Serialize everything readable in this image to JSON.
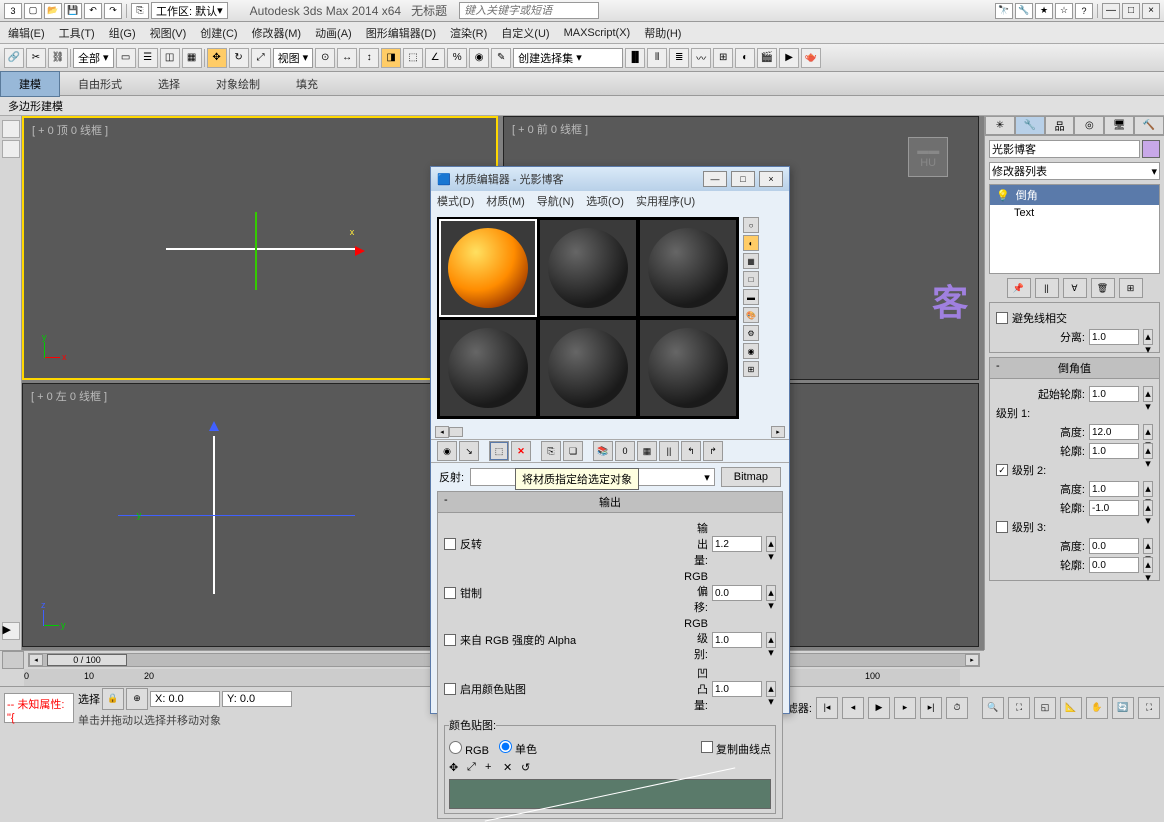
{
  "titlebar": {
    "workspace_label": "工作区: 默认",
    "app_title": "Autodesk 3ds Max  2014 x64",
    "doc_title": "无标题",
    "search_placeholder": "键入关键字或短语"
  },
  "menubar": [
    "编辑(E)",
    "工具(T)",
    "组(G)",
    "视图(V)",
    "创建(C)",
    "修改器(M)",
    "动画(A)",
    "图形编辑器(D)",
    "渲染(R)",
    "自定义(U)",
    "MAXScript(X)",
    "帮助(H)"
  ],
  "toolbar": {
    "filter": "全部",
    "coord": "视图",
    "selset": "创建选择集"
  },
  "ribbon": {
    "tabs": [
      "建模",
      "自由形式",
      "选择",
      "对象绘制",
      "填充"
    ],
    "active": 0,
    "sub": "多边形建模"
  },
  "viewports": {
    "tl": "[ + 0 顶 0 线框 ]",
    "tr": "[ + 0 前 0 线框 ]",
    "bl": "[ + 0 左 0 线框 ]"
  },
  "cmdpanel": {
    "name": "光影博客",
    "modlist": "修改器列表",
    "stack": [
      {
        "label": "倒角",
        "icon": "💡"
      },
      {
        "label": "Text",
        "icon": ""
      }
    ],
    "rollout1": {
      "title": "",
      "avoid_overlap": "避免线相交",
      "separate": "分离:",
      "separate_v": "1.0"
    },
    "rollout2": {
      "title": "倒角值",
      "start_outline": "起始轮廓:",
      "start_outline_v": "1.0",
      "level1": "级别 1:",
      "height1": "高度:",
      "height1_v": "12.0",
      "outline1": "轮廓:",
      "outline1_v": "1.0",
      "level2": "级别 2:",
      "height2": "高度:",
      "height2_v": "1.0",
      "outline2": "轮廓:",
      "outline2_v": "-1.0",
      "level3": "级别 3:",
      "height3": "高度:",
      "height3_v": "0.0",
      "outline3": "轮廓:",
      "outline3_v": "0.0"
    }
  },
  "mateditor": {
    "title": "材质编辑器 - 光影博客",
    "menu": [
      "模式(D)",
      "材质(M)",
      "导航(N)",
      "选项(O)",
      "实用程序(U)"
    ],
    "tooltip": "将材质指定给选定对象",
    "reflect": "反射:",
    "type_dd": "",
    "type_btn": "Bitmap",
    "output": {
      "title": "输出",
      "invert": "反转",
      "output_amt": "输出量:",
      "output_amt_v": "1.2",
      "clamp": "钳制",
      "rgb_offset": "RGB 偏移:",
      "rgb_offset_v": "0.0",
      "alpha_rgb": "来自 RGB 强度的 Alpha",
      "rgb_level": "RGB 级别:",
      "rgb_level_v": "1.0",
      "color_map": "启用颜色贴图",
      "bump_amt": "凹凸量:",
      "bump_amt_v": "1.0",
      "colormap_title": "颜色贴图:",
      "rgb_radio": "RGB",
      "mono_radio": "单色",
      "copy_curve": "复制曲线点"
    }
  },
  "timeline": {
    "frame": "0 / 100",
    "ticks": [
      "0",
      "10",
      "20",
      "100"
    ]
  },
  "status": {
    "prompt": "选择",
    "x": "X: 0.0",
    "y": "Y: 0.0",
    "red_text": "-- 未知属性: \"{",
    "hint": "单击并拖动以选择并移动对象",
    "filter": "点过滤器:",
    "ruler_100": "100"
  }
}
